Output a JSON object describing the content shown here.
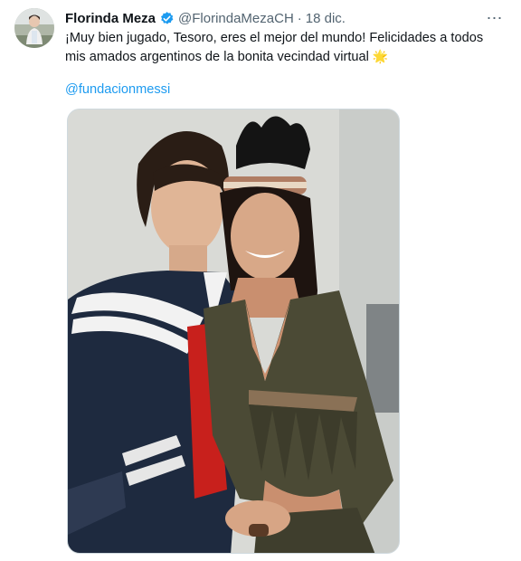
{
  "tweet": {
    "author_name": "Florinda Meza",
    "handle": "@FlorindaMezaCH",
    "separator": "·",
    "date": "18 dic.",
    "text": "¡Muy bien jugado, Tesoro, eres el mejor del mundo! Felicidades a todos mis amados argentinos de la bonita vecindad virtual",
    "emoji": "🌟",
    "mention": "@fundacionmessi",
    "more_icon": "⋯"
  },
  "colors": {
    "link": "#1d9bf0",
    "verified": "#1d9bf0",
    "secondary_text": "#536471",
    "primary_text": "#0f1419"
  },
  "icons": {
    "verified": "verified-badge-icon",
    "more": "more-options-icon"
  }
}
